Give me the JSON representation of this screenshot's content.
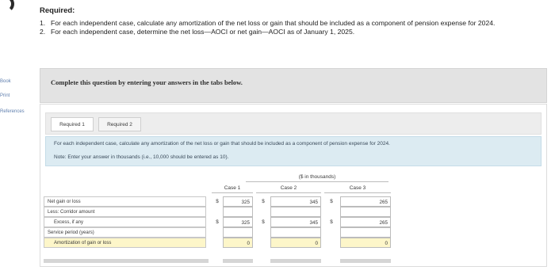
{
  "sidebar": {
    "links": [
      "Book",
      "Print",
      "References"
    ]
  },
  "required": {
    "title": "Required:",
    "items": [
      {
        "num": "1.",
        "text": "For each independent case, calculate any amortization of the net loss or gain that should be included as a component of pension expense for 2024."
      },
      {
        "num": "2.",
        "text": "For each independent case, determine the net loss—AOCI or net gain—AOCI as of January 1, 2025."
      }
    ]
  },
  "banner": {
    "text": "Complete this question by entering your answers in the tabs below."
  },
  "tabs": [
    {
      "label": "Required 1",
      "active": true
    },
    {
      "label": "Required 2",
      "active": false
    }
  ],
  "prompt": {
    "line1": "For each independent case, calculate any amortization of the net loss or gain that should be included as a component of pension expense for 2024.",
    "line2": "Note: Enter your answer in thousands (i.e., 10,000 should be entered as 10)."
  },
  "table": {
    "units_header": "($ in thousands)",
    "cases": [
      "Case 1",
      "Case 2",
      "Case 3"
    ],
    "currency_symbol": "$",
    "rows": [
      {
        "label": "Net gain or loss",
        "values": [
          "325",
          "345",
          "265"
        ],
        "dollar": true
      },
      {
        "label": "Less: Corridor amount",
        "values": [
          "",
          "",
          ""
        ],
        "dollar": false
      },
      {
        "label": "Excess, if any",
        "values": [
          "325",
          "345",
          "265"
        ],
        "dollar": true
      },
      {
        "label": "Service period (years)",
        "values": [
          "",
          "",
          ""
        ],
        "dollar": false
      },
      {
        "label": "Amortization of gain or loss",
        "values": [
          "0",
          "0",
          "0"
        ],
        "dollar": false
      }
    ]
  },
  "colors": {
    "prompt_bg": "#dcebf2",
    "yellow_input": "#fdf6c9",
    "banner_bg": "#e3e3e3"
  }
}
